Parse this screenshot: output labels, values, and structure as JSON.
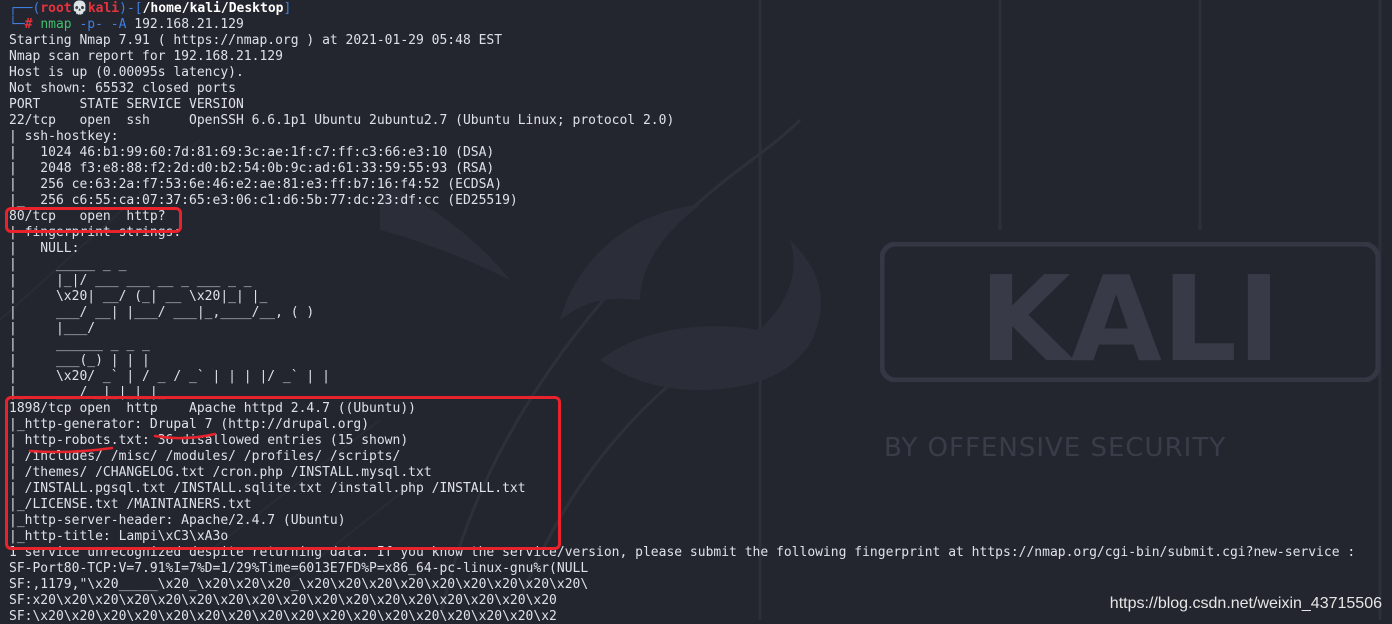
{
  "prompt": {
    "corner_top": "┌──(",
    "user": "root",
    "skull": "💀",
    "host": "kali",
    "sep": ")-[",
    "cwd": "/home/kali/Desktop",
    "close": "]",
    "corner_bottom": "└─",
    "hash": "# ",
    "command": "nmap",
    "args": " -p- -A ",
    "target": "192.168.21.129"
  },
  "output_lines": [
    "Starting Nmap 7.91 ( https://nmap.org ) at 2021-01-29 05:48 EST",
    "Nmap scan report for 192.168.21.129",
    "Host is up (0.00095s latency).",
    "Not shown: 65532 closed ports",
    "PORT     STATE SERVICE VERSION",
    "22/tcp   open  ssh     OpenSSH 6.6.1p1 Ubuntu 2ubuntu2.7 (Ubuntu Linux; protocol 2.0)",
    "| ssh-hostkey:",
    "|   1024 46:b1:99:60:7d:81:69:3c:ae:1f:c7:ff:c3:66:e3:10 (DSA)",
    "|   2048 f3:e8:88:f2:2d:d0:b2:54:0b:9c:ad:61:33:59:55:93 (RSA)",
    "|   256 ce:63:2a:f7:53:6e:46:e2:ae:81:e3:ff:b7:16:f4:52 (ECDSA)",
    "|_  256 c6:55:ca:07:37:65:e3:06:c1:d6:5b:77:dc:23:df:cc (ED25519)",
    "80/tcp   open  http?",
    "| fingerprint-strings:",
    "|   NULL:",
    "|     _____ _ _",
    "|     |_|/ ___ ___ __ _ ___ _ _",
    "|     \\x20| __/ (_| __ \\x20|_| |_",
    "|     ___/ __| |___/ ___|_,____/__, ( )",
    "|     |___/",
    "|     ______ _ _ _",
    "|     ___(_) | | |",
    "|     \\x20/ _` | / _ / _` | | | |/ _` | |",
    "|_    ___/ _|_|_|_|_",
    "1898/tcp open  http    Apache httpd 2.4.7 ((Ubuntu))",
    "|_http-generator: Drupal 7 (http://drupal.org)",
    "| http-robots.txt: 36 disallowed entries (15 shown)",
    "| /includes/ /misc/ /modules/ /profiles/ /scripts/",
    "| /themes/ /CHANGELOG.txt /cron.php /INSTALL.mysql.txt",
    "| /INSTALL.pgsql.txt /INSTALL.sqlite.txt /install.php /INSTALL.txt",
    "|_/LICENSE.txt /MAINTAINERS.txt",
    "|_http-server-header: Apache/2.4.7 (Ubuntu)",
    "|_http-title: Lampi\\xC3\\xA3o",
    "1 service unrecognized despite returning data. If you know the service/version, please submit the following fingerprint at https://nmap.org/cgi-bin/submit.cgi?new-service :",
    "SF-Port80-TCP:V=7.91%I=7%D=1/29%Time=6013E7FD%P=x86_64-pc-linux-gnu%r(NULL",
    "SF:,1179,\"\\x20_____\\x20_\\x20\\x20\\x20_\\x20\\x20\\x20\\x20\\x20\\x20\\x20\\x20\\x20\\",
    "SF:x20\\x20\\x20\\x20\\x20\\x20\\x20\\x20\\x20\\x20\\x20\\x20\\x20\\x20\\x20\\x20\\x20",
    "SF:\\x20\\x20\\x20\\x20\\x20\\x20\\x20\\x20\\x20\\x20\\x20\\x20\\x20\\x20\\x20\\x20\\x2"
  ],
  "background": {
    "logo_text": "KALI",
    "tagline": "BY OFFENSIVE SECURITY"
  },
  "watermark": "https://blog.csdn.net/weixin_43715506",
  "colors": {
    "background": "#24262f",
    "text": "#dfe1e8",
    "prompt_frame": "#3f7fe0",
    "prompt_user": "#e8333e",
    "command": "#3fbf6a",
    "highlight": "#e8232b"
  }
}
